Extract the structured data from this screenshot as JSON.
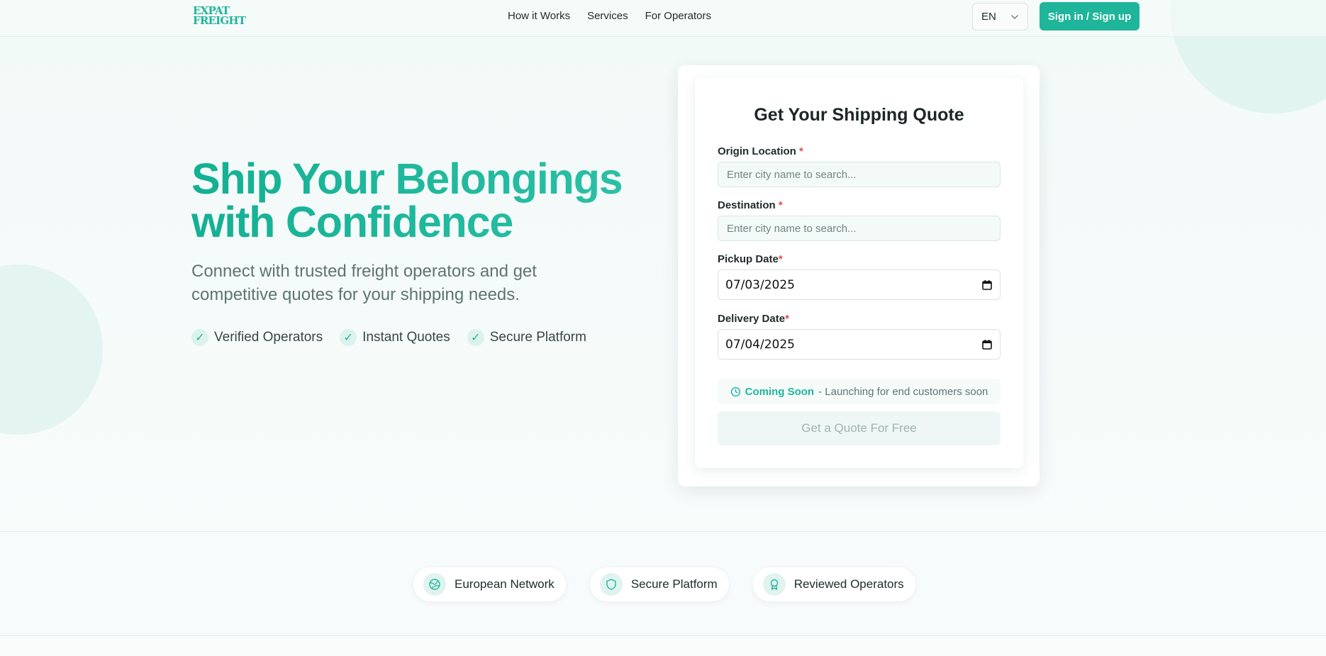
{
  "brand": {
    "logo_line1": "EXPAT",
    "logo_line2": "FREIGHT",
    "accent": "#1fb59a"
  },
  "nav": {
    "items": [
      "How it Works",
      "Services",
      "For Operators"
    ]
  },
  "header": {
    "language": "EN",
    "signin_label": "Sign in / Sign up"
  },
  "hero": {
    "title_line1": "Ship Your Belongings",
    "title_line2": "with Confidence",
    "subtitle": "Connect with trusted freight operators and get competitive quotes for your shipping needs.",
    "features": [
      "Verified Operators",
      "Instant Quotes",
      "Secure Platform"
    ]
  },
  "quote_form": {
    "title": "Get Your Shipping Quote",
    "origin": {
      "label": "Origin Location",
      "required_mark": "*",
      "placeholder": "Enter city name to search..."
    },
    "destination": {
      "label": "Destination",
      "required_mark": "*",
      "placeholder": "Enter city name to search..."
    },
    "pickup": {
      "label": "Pickup Date",
      "required_mark": "*",
      "value": "07/03/2025"
    },
    "delivery": {
      "label": "Delivery Date",
      "required_mark": "*",
      "value": "07/04/2025"
    },
    "notice": {
      "highlight": "Coming Soon",
      "text": "- Launching for end customers soon"
    },
    "submit_label": "Get a Quote For Free"
  },
  "trust": {
    "items": [
      {
        "label": "European Network",
        "icon": "globe-icon"
      },
      {
        "label": "Secure Platform",
        "icon": "shield-icon"
      },
      {
        "label": "Reviewed Operators",
        "icon": "award-icon"
      }
    ]
  }
}
